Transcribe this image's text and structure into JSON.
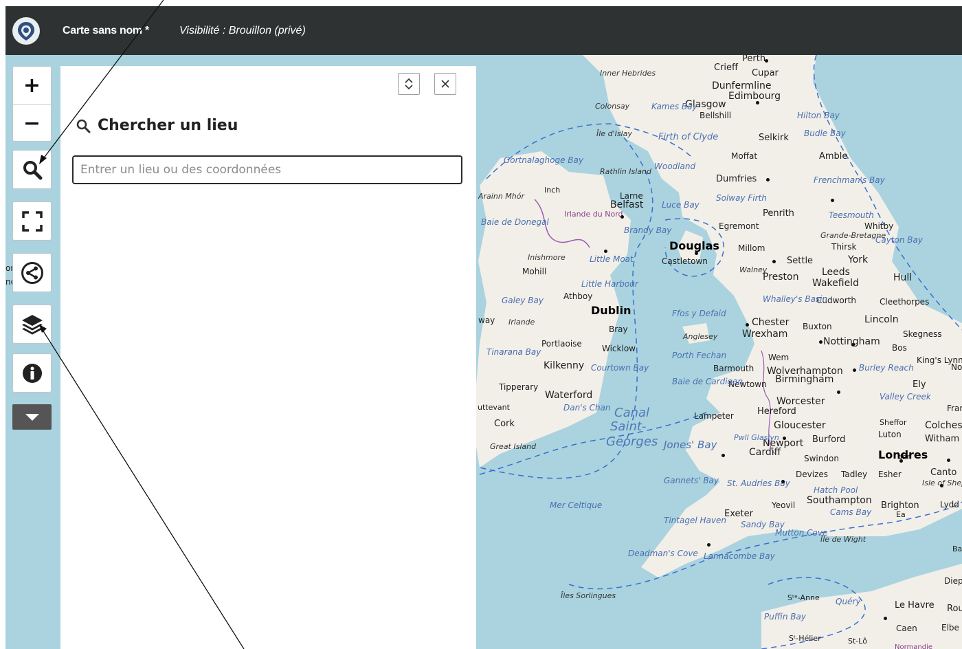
{
  "header": {
    "title": "Carte sans nom *",
    "visibility": "Visibilité : Brouillon (privé)"
  },
  "toolbar": {
    "zoom_in": "+",
    "zoom_out": "−"
  },
  "panel": {
    "heading": "Chercher un lieu",
    "search_placeholder": "Entrer un lieu ou des coordonnées"
  },
  "map": {
    "places": [
      "Perth",
      "Crieff",
      "Cupar",
      "Dunfermline",
      "Edimbourg",
      "Glasgow",
      "Bellshill",
      "Selkirk",
      "Moffat",
      "Amble",
      "Dumfries",
      "Penrith",
      "Egremont",
      "Whitby",
      "Thirsk",
      "York",
      "Millom",
      "Settle",
      "Leeds",
      "Wakefield",
      "Hull",
      "Preston",
      "Cudworth",
      "Cleethorpes",
      "Lincoln",
      "Chester",
      "Buxton",
      "Skegness",
      "Wrexham",
      "Nottingham",
      "Bos",
      "Wem",
      "Barmouth",
      "Wolverhampton",
      "Birmingham",
      "Ely",
      "Newtown",
      "Worcester",
      "Hereford",
      "Lampeter",
      "Gloucester",
      "Colches",
      "Luton",
      "Witham",
      "Burford",
      "Newport",
      "Cardiff",
      "Swindon",
      "Devizes",
      "Tadley",
      "Esher",
      "Canto",
      "Yeovil",
      "Southampton",
      "Brighton",
      "Lydd",
      "Exeter",
      "Belfast",
      "Larne",
      "Inch",
      "Mohill",
      "Athboy",
      "Bray",
      "Wicklow",
      "Portlaoise",
      "Kilkenny",
      "Tipperary",
      "Waterford",
      "Cork",
      "Castletown",
      "Caen",
      "Le Havre",
      "Elbe",
      "Diep",
      "Rou",
      "St-Lô",
      "Sᵗ-Hélier",
      "Sᵗᵉ-Anne",
      "ord",
      "nock",
      "way",
      "uttevant",
      "don",
      "Fran",
      "Sheffor",
      "Ea",
      "Ba"
    ],
    "major_places": [
      "Douglas",
      "Dublin",
      "Londres"
    ],
    "water": [
      "Inner Hebrides",
      "Colonsay",
      "Kames Bay",
      "Île d'Islay",
      "Firth of Clyde",
      "Gortnalaghoge Bay",
      "Rathlin Island",
      "Woodland",
      "Arainn Mhór",
      "Luce Bay",
      "Solway Firth",
      "Frenchman's Bay",
      "Teesmouth",
      "Hilton Bay",
      "Budle Bay",
      "Baie de Donegal",
      "Brandy Bay",
      "Inishmore",
      "Little Moat",
      "Little Harbour",
      "Walney",
      "Cayton Bay",
      "Galey Bay",
      "Ffos y Defaid",
      "Whalley's Basin",
      "Anglesey",
      "Tinarana Bay",
      "Porth Fechan",
      "Courtown Bay",
      "Baie de Cardigan",
      "Burley Reach",
      "Dan's Chan",
      "Valley Creek",
      "Great Island",
      "Pwll Glaslyn",
      "Jones' Bay",
      "Gannets' Bay",
      "St. Audries Bay",
      "Hatch Pool",
      "Cams Bay",
      "Mer Celtique",
      "Tintagel Haven",
      "Sandy Bay",
      "Mutton Cove",
      "Île de Wight",
      "Deadman's Cove",
      "Lannacombe Bay",
      "Îles Sorlingues",
      "Quéry",
      "Puffin Bay",
      "King's Lynn",
      "No",
      "Isle of Shep",
      "Grande-Bretagne",
      "Normandie"
    ],
    "seas": [
      "Canal",
      "Saint-",
      "Georges"
    ],
    "regions": [
      "Irlande du Nord",
      "Irlande"
    ]
  },
  "colors": {
    "header_bg": "#2f3233",
    "map_water": "#aad3df",
    "map_land": "#f2efe9"
  }
}
